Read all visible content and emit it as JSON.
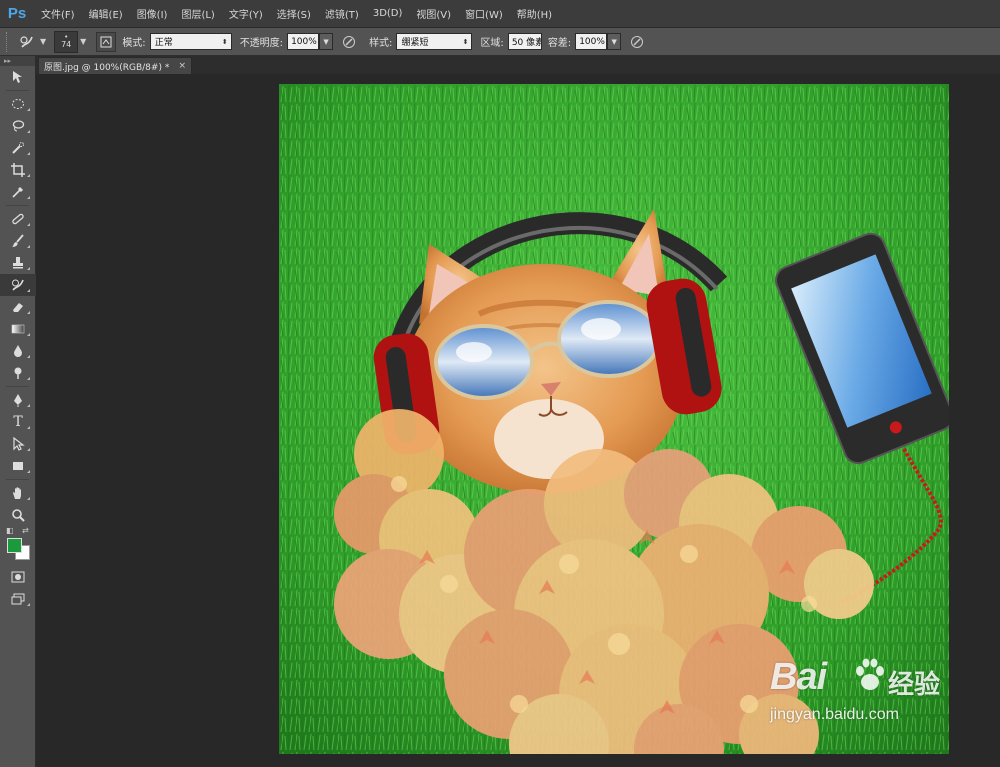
{
  "app": {
    "logo": "Ps"
  },
  "menu": [
    "文件(F)",
    "编辑(E)",
    "图像(I)",
    "图层(L)",
    "文字(Y)",
    "选择(S)",
    "滤镜(T)",
    "3D(D)",
    "视图(V)",
    "窗口(W)",
    "帮助(H)"
  ],
  "options": {
    "brush_size": "74",
    "mode_label": "模式:",
    "mode_value": "正常",
    "opacity_label": "不透明度:",
    "opacity_value": "100%",
    "style_label": "样式:",
    "style_value": "绷紧短",
    "area_label": "区域:",
    "area_value": "50 像素",
    "tolerance_label": "容差:",
    "tolerance_value": "100%"
  },
  "document": {
    "tab_title": "原图.jpg @ 100%(RGB/8#) *",
    "close_glyph": "×"
  },
  "colors": {
    "foreground": "#1a9a3c",
    "background": "#ffffff",
    "accent": "#4ea7e8"
  },
  "tools": [
    "move-tool",
    "marquee-tool",
    "lasso-tool",
    "quick-selection-tool",
    "crop-tool",
    "eyedropper-tool",
    "healing-brush-tool",
    "brush-tool",
    "clone-stamp-tool",
    "art-history-brush-tool",
    "eraser-tool",
    "gradient-tool",
    "blur-tool",
    "dodge-tool",
    "pen-tool",
    "type-tool",
    "path-selection-tool",
    "rectangle-tool",
    "hand-tool",
    "zoom-tool"
  ],
  "watermark": {
    "brand": "Bai",
    "brand_suffix": "经验",
    "url": "jingyan.baidu.com"
  }
}
